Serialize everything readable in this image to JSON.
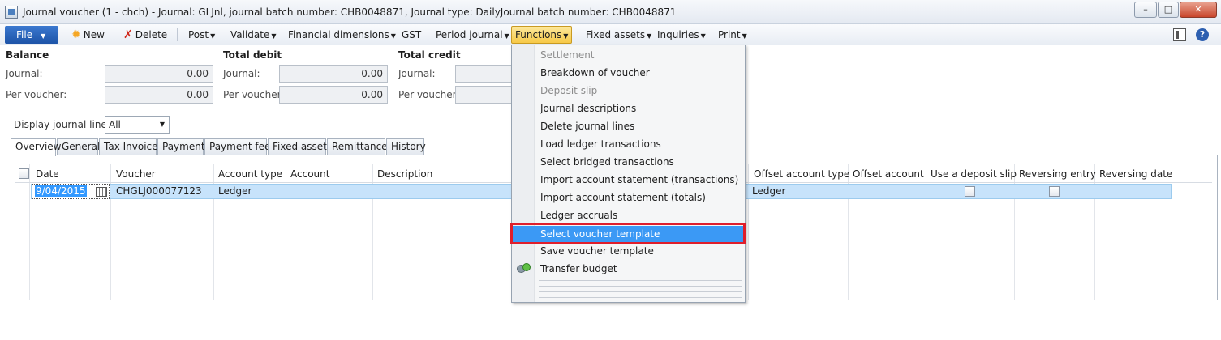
{
  "window": {
    "title": "Journal voucher (1 - chch) - Journal: GLJnl, journal batch number: CHB0048871, Journal type: DailyJournal batch number: CHB0048871",
    "min": "–",
    "max": "□",
    "close": "✕"
  },
  "toolbar": {
    "file": "File",
    "new": "New",
    "delete": "Delete",
    "post": "Post",
    "validate": "Validate",
    "financial_dimensions": "Financial dimensions",
    "gst": "GST",
    "period_journal": "Period journal",
    "functions": "Functions",
    "fixed_assets": "Fixed assets",
    "inquiries": "Inquiries",
    "print": "Print",
    "help": "?"
  },
  "totals": {
    "balance": {
      "title": "Balance",
      "journal_label": "Journal:",
      "journal_value": "0.00",
      "voucher_label": "Per voucher:",
      "voucher_value": "0.00"
    },
    "debit": {
      "title": "Total debit",
      "journal_label": "Journal:",
      "journal_value": "0.00",
      "voucher_label": "Per voucher:",
      "voucher_value": "0.00"
    },
    "credit": {
      "title": "Total credit",
      "journal_label": "Journal:",
      "voucher_label": "Per voucher:"
    }
  },
  "display_lines": {
    "label": "Display journal lines:",
    "value": "All"
  },
  "tabs": [
    "Overview",
    "General",
    "Tax Invoice",
    "Payment",
    "Payment fee",
    "Fixed assets",
    "Remittance",
    "History"
  ],
  "grid": {
    "headers": {
      "date": "Date",
      "voucher": "Voucher",
      "account_type": "Account type",
      "account": "Account",
      "description": "Description",
      "offset_account_type": "Offset account type",
      "offset_account": "Offset account",
      "deposit_slip": "Use a deposit slip",
      "reversing_entry": "Reversing entry",
      "reversing_date": "Reversing date"
    },
    "row": {
      "date": "9/04/2015",
      "voucher": "CHGLJ000077123",
      "account_type": "Ledger",
      "offset_account_type": "Ledger",
      "deposit_slip": false,
      "reversing_entry": false
    }
  },
  "functions_menu": {
    "items": [
      {
        "label": "Settlement",
        "disabled": true
      },
      {
        "label": "Breakdown of voucher",
        "disabled": false
      },
      {
        "label": "Deposit slip",
        "disabled": true
      },
      {
        "label": "Journal descriptions",
        "disabled": false
      },
      {
        "label": "Delete journal lines",
        "disabled": false
      },
      {
        "label": "Load ledger transactions",
        "disabled": false
      },
      {
        "label": "Select bridged transactions",
        "disabled": false
      },
      {
        "label": "Import account statement (transactions)",
        "disabled": false
      },
      {
        "label": "Import account statement (totals)",
        "disabled": false
      },
      {
        "label": "Ledger accruals",
        "disabled": false
      },
      {
        "label": "Select voucher template",
        "disabled": false,
        "highlighted": true
      },
      {
        "label": "Save voucher template",
        "disabled": false
      },
      {
        "label": "Transfer budget",
        "disabled": false
      }
    ],
    "highlight_color": "#3b99f5",
    "callout_color": "#e01e2b"
  }
}
